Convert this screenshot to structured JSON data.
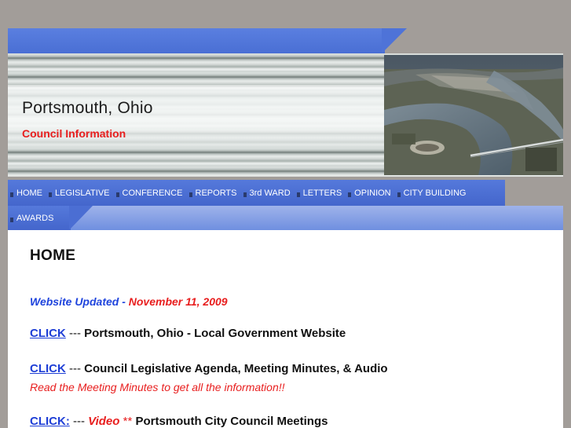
{
  "header": {
    "title": "Portsmouth, Ohio",
    "subtitle": "Council Information"
  },
  "nav": {
    "items": [
      {
        "label": "HOME"
      },
      {
        "label": "LEGISLATIVE"
      },
      {
        "label": "CONFERENCE"
      },
      {
        "label": "REPORTS"
      },
      {
        "label": "3rd WARD"
      },
      {
        "label": "LETTERS"
      },
      {
        "label": "OPINION"
      },
      {
        "label": "CITY BUILDING"
      },
      {
        "label": "AWARDS"
      }
    ]
  },
  "main": {
    "heading": "HOME",
    "updated_label": "Website Updated -",
    "updated_date": "November 11, 2009",
    "links": [
      {
        "click": "CLICK",
        "sep": " --- ",
        "text": "Portsmouth, Ohio - Local Government Website"
      },
      {
        "click": "CLICK",
        "sep": " --- ",
        "text": "Council Legislative Agenda, Meeting Minutes, & Audio",
        "note": "Read the Meeting Minutes to get all the information!!"
      },
      {
        "click": "CLICK:",
        "sep": " --- ",
        "video": "Video",
        "stars": " ** ",
        "text": "Portsmouth City Council Meetings"
      }
    ]
  },
  "colors": {
    "accent_blue": "#4a6fd4",
    "title_red": "#e81e1e",
    "link_blue": "#1f3fd6"
  },
  "icons": {
    "nav_bullet": "square-bullet-icon",
    "aerial_photo": "aerial-city-photo"
  }
}
